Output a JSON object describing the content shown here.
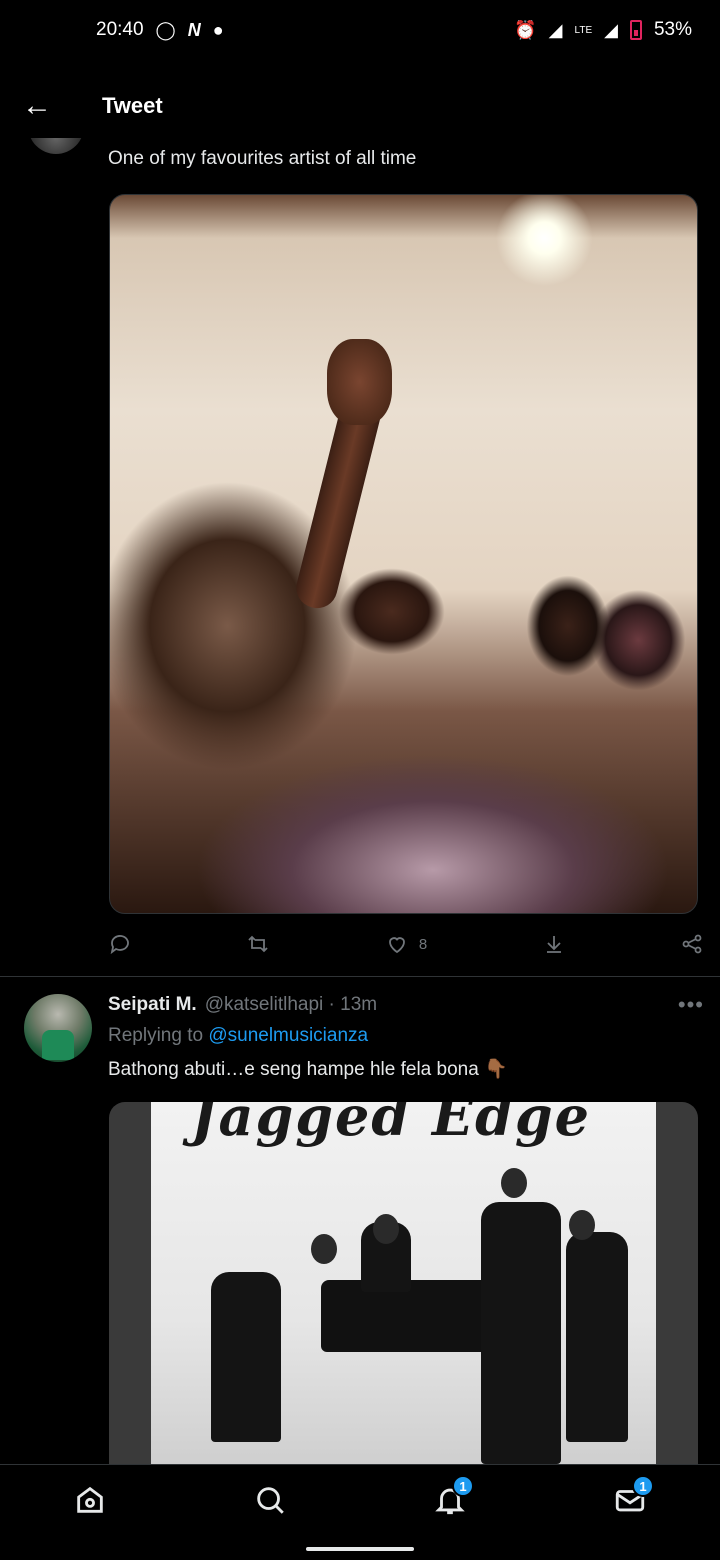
{
  "status_bar": {
    "time": "20:40",
    "left_icons": [
      "whatsapp-icon",
      "n-icon",
      "chat-icon"
    ],
    "battery": "53%",
    "network": "LTE"
  },
  "header": {
    "title": "Tweet"
  },
  "tweet": {
    "text": "One of my favourites artist of all time",
    "likes": "8"
  },
  "reply": {
    "name": "Seipati M.",
    "handle": "@katselitlhapi · 13m",
    "replying_prefix": "Replying to ",
    "replying_to": "@sunelmusicianza",
    "text": "Bathong abuti…e seng hampe hle fela bona 👇🏾",
    "poster_title": "Jagged Edge"
  },
  "bottom_nav": {
    "notifications_badge": "1",
    "messages_badge": "1"
  },
  "colors": {
    "accent": "#1d9bf0",
    "muted": "#71767b",
    "background": "#000000"
  }
}
